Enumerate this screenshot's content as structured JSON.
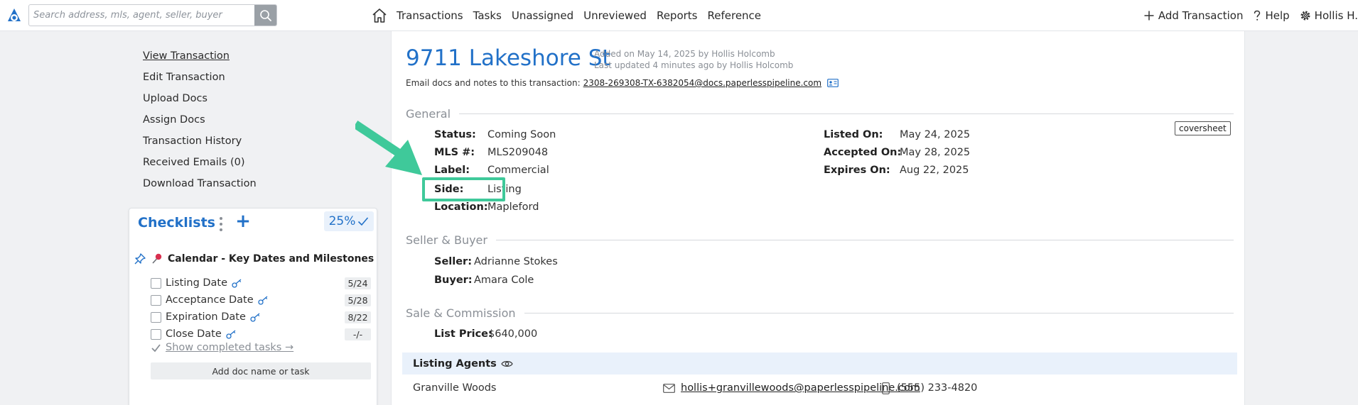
{
  "search": {
    "placeholder": "Search address, mls, agent, seller, buyer"
  },
  "nav": {
    "links": [
      "Transactions",
      "Tasks",
      "Unassigned",
      "Unreviewed",
      "Reports",
      "Reference"
    ],
    "add_transaction": "Add Transaction",
    "help": "Help",
    "user": "Hollis H."
  },
  "sidebar": {
    "items": [
      "View Transaction",
      "Edit Transaction",
      "Upload Docs",
      "Assign Docs",
      "Transaction History",
      "Received Emails (0)",
      "Download Transaction"
    ]
  },
  "checklists": {
    "title": "Checklists",
    "progress": "25%",
    "group_label": "Calendar - Key Dates and Milestones",
    "tasks": [
      {
        "label": "Listing Date",
        "date": "5/24"
      },
      {
        "label": "Acceptance Date",
        "date": "5/28"
      },
      {
        "label": "Expiration Date",
        "date": "8/22"
      },
      {
        "label": "Close Date",
        "date": "-/-"
      }
    ],
    "show_completed": "Show completed tasks →",
    "add_doc": "Add doc name or task"
  },
  "transaction": {
    "address": "9711 Lakeshore St",
    "added": "Added on May 14, 2025 by Hollis Holcomb",
    "updated": "Last updated 4 minutes ago by Hollis Holcomb",
    "email_label": "Email docs and notes to this transaction:",
    "email": "2308-269308-TX-6382054@docs.paperlesspipeline.com"
  },
  "general": {
    "title": "General",
    "coversheet": "coversheet",
    "status_label": "Status:",
    "status": "Coming Soon",
    "mls_label": "MLS #:",
    "mls": "MLS209048",
    "label_label": "Label:",
    "label": "Commercial",
    "side_label": "Side:",
    "side": "Listing",
    "location_label": "Location:",
    "location": "Mapleford",
    "listed_label": "Listed On:",
    "listed": "May 24, 2025",
    "accepted_label": "Accepted On:",
    "accepted": "May 28, 2025",
    "expires_label": "Expires On:",
    "expires": "Aug 22, 2025"
  },
  "seller_buyer": {
    "title": "Seller & Buyer",
    "seller_label": "Seller:",
    "seller": "Adrianne Stokes",
    "buyer_label": "Buyer:",
    "buyer": "Amara Cole"
  },
  "sale": {
    "title": "Sale & Commission",
    "list_price_label": "List Price:",
    "list_price": "$640,000"
  },
  "agents": {
    "title": "Listing Agents",
    "name": "Granville Woods",
    "email": "hollis+granvillewoods@paperlesspipeline.com",
    "phone": "(555) 233-4820"
  },
  "colors": {
    "brand_blue": "#2271c8",
    "highlight_green": "#3fc99a",
    "pin_red": "#d9304f"
  }
}
